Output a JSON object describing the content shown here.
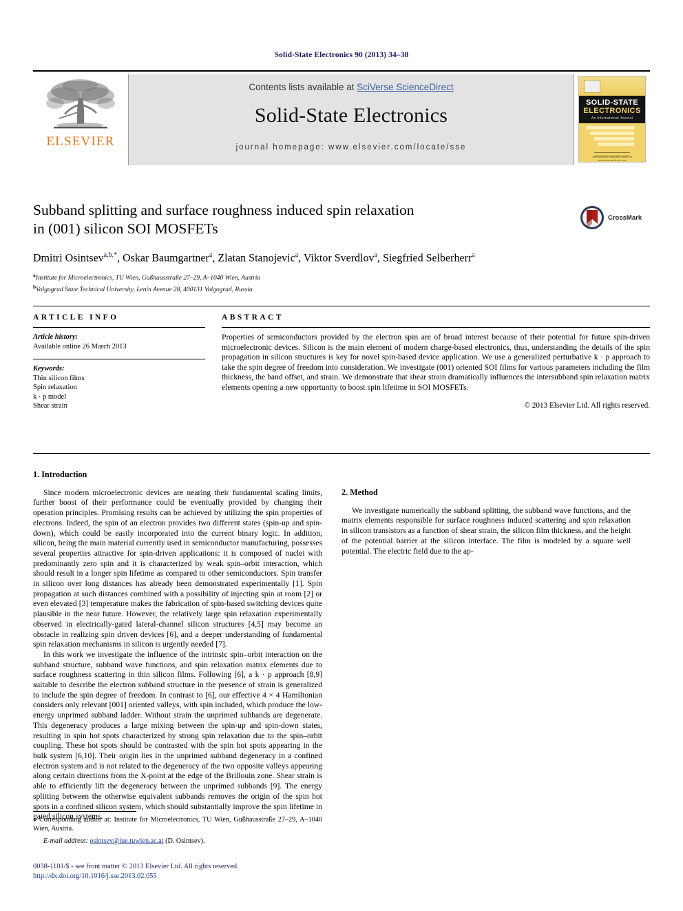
{
  "running_head": "Solid-State Electronics 90 (2013) 34–38",
  "masthead": {
    "contents_prefix": "Contents lists available at ",
    "sciverse_link": "SciVerse ScienceDirect",
    "journal_title": "Solid-State Electronics",
    "journal_homepage": "journal homepage: www.elsevier.com/locate/sse",
    "publisher_wordmark": "ELSEVIER",
    "cover": {
      "line1": "SOLID-STATE",
      "line2": "ELECTRONICS",
      "line3": "An International Journal",
      "footer": "ScienceDirect available online at www.sciencedirect.com"
    }
  },
  "article": {
    "title_line1": "Subband splitting and surface roughness induced spin relaxation",
    "title_line2": "in (001) silicon SOI MOSFETs",
    "authors": [
      {
        "name": "Dmitri Osintsev",
        "sup": "a,b,*"
      },
      {
        "name": "Oskar Baumgartner",
        "sup": "a"
      },
      {
        "name": "Zlatan Stanojevic",
        "sup": "a"
      },
      {
        "name": "Viktor Sverdlov",
        "sup": "a"
      },
      {
        "name": "Siegfried Selberherr",
        "sup": "a"
      }
    ],
    "affiliations": [
      {
        "marker": "a",
        "text": "Institute for Microelectronics, TU Wien, Gußhausstraße 27–29, A–1040 Wien, Austria"
      },
      {
        "marker": "b",
        "text": "Volgograd State Technical University, Lenin Avenue 28, 400131 Volgograd, Russia"
      }
    ],
    "crossmark_label": "CrossMark"
  },
  "article_info": {
    "heading": "ARTICLE INFO",
    "history_label": "Article history:",
    "history_value": "Available online 26 March 2013",
    "keywords_label": "Keywords:",
    "keywords": [
      "Thin silicon films",
      "Spin relaxation",
      "k · p model",
      "Shear strain"
    ]
  },
  "abstract": {
    "heading": "ABSTRACT",
    "body": "Properties of semiconductors provided by the electron spin are of broad interest because of their potential for future spin-driven microelectronic devices. Silicon is the main element of modern charge-based electronics, thus, understanding the details of the spin propagation in silicon structures is key for novel spin-based device application. We use a generalized perturbative k · p approach to take the spin degree of freedom into consideration. We investigate (001) oriented SOI films for various parameters including the film thickness, the band offset, and strain. We demonstrate that shear strain dramatically influences the intersubband spin relaxation matrix elements opening a new opportunity to boost spin lifetime in SOI MOSFETs.",
    "copyright": "© 2013 Elsevier Ltd. All rights reserved."
  },
  "sections": {
    "intro_heading": "1. Introduction",
    "intro_p1": "Since modern microelectronic devices are nearing their fundamental scaling limits, further boost of their performance could be eventually provided by changing their operation principles. Promising results can be achieved by utilizing the spin properties of electrons. Indeed, the spin of an electron provides two different states (spin-up and spin-down), which could be easily incorporated into the current binary logic. In addition, silicon, being the main material currently used in semiconductor manufacturing, possesses several properties attractive for spin-driven applications: it is composed of nuclei with predominantly zero spin and it is characterized by weak spin–orbit interaction, which should result in a longer spin lifetime as compared to other semiconductors. Spin transfer in silicon over long distances has already been demonstrated experimentally [1]. Spin propagation at such distances combined with a possibility of injecting spin at room [2] or even elevated [3] temperature makes the fabrication of spin-based switching devices quite plausible in the near future. However, the relatively large spin relaxation experimentally observed in electrically-gated lateral-channel silicon structures [4,5] may become an obstacle in realizing spin driven devices [6], and a deeper understanding of fundamental spin relaxation mechanisms in silicon is urgently needed [7].",
    "intro_p2": "In this work we investigate the influence of the intrinsic spin–orbit interaction on the subband structure, subband wave functions, and spin relaxation matrix elements due to surface roughness scattering in thin silicon films. Following [6], a k · p approach [8,9] suitable to describe the electron subband structure in the presence of strain is generalized to include the spin degree of freedom. In contrast to [6], our effective 4 × 4 Hamiltonian considers only relevant [001] oriented valleys, with spin included, which produce the low-energy unprimed subband ladder. Without strain the unprimed subbands are degenerate. This degeneracy produces a large mixing between the spin-up and spin-down states, resulting in spin hot spots characterized by strong spin relaxation due to the spin–orbit coupling. These hot spots should be contrasted with the spin hot spots appearing in the bulk system [6,10]. Their origin lies in the unprimed subband degeneracy in a confined electron system and is not related to the degeneracy of the two opposite valleys appearing along certain directions from the X-point at the edge of the Brillouin zone. Shear strain is able to efficiently lift the degeneracy between the unprimed subbands [9]. The energy splitting between the otherwise equivalent subbands removes the origin of the spin hot spots in a confined silicon system, which should substantially improve the spin lifetime in gated silicon systems.",
    "method_heading": "2. Method",
    "method_p1": "We investigate numerically the subband splitting, the subband wave functions, and the matrix elements responsible for surface roughness induced scattering and spin relaxation in silicon transistors as a function of shear strain, the silicon film thickness, and the height of the potential barrier at the silicon interface. The film is modeled by a square well potential. The electric field due to the ap-"
  },
  "footnotes": {
    "corresponding": "Corresponding author at: Institute for Microelectronics, TU Wien, Gußhausstraße 27–29, A–1040 Wien, Austria.",
    "email_label": "E-mail address:",
    "email_link": "osintsev@iue.tuwien.ac.at",
    "email_suffix": "(D. Osintsev).",
    "issn_line": "0038-1101/$ - see front matter © 2013 Elsevier Ltd. All rights reserved.",
    "doi_line": "http://dx.doi.org/10.1016/j.sse.2013.02.055"
  }
}
